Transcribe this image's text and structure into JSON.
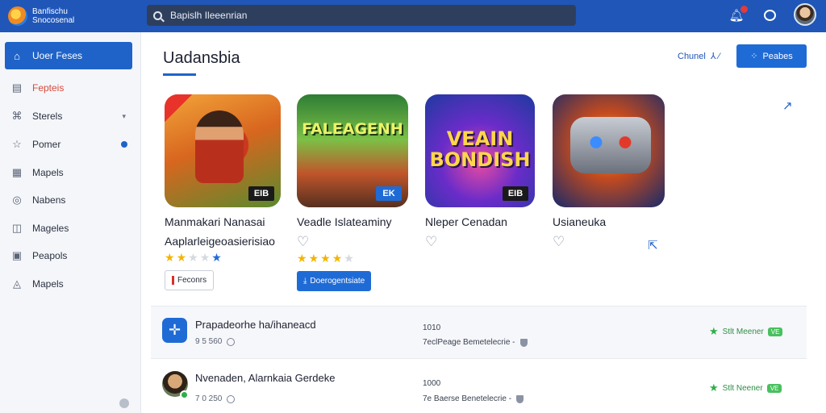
{
  "app": {
    "brand_line1": "Banfischu",
    "brand_line2": "Snocosenal"
  },
  "search": {
    "value": "Bapislh Ileeenrian"
  },
  "sidebar": {
    "items": [
      {
        "label": "Uoer Feses",
        "icon": "home-icon"
      },
      {
        "label": "Fepteis",
        "icon": "calendar-icon"
      },
      {
        "label": "Sterels",
        "icon": "tag-icon"
      },
      {
        "label": "Pomer",
        "icon": "star-icon"
      },
      {
        "label": "Mapels",
        "icon": "grid-icon"
      },
      {
        "label": "Nabens",
        "icon": "circle-icon"
      },
      {
        "label": "Mageles",
        "icon": "chart-icon"
      },
      {
        "label": "Peapols",
        "icon": "image-icon"
      },
      {
        "label": "Mapels",
        "icon": "pin-icon"
      }
    ]
  },
  "main": {
    "title": "Uadansbia",
    "header_link": "Chunel",
    "header_link_icons": "⅄ ⁄",
    "primary_button": "Peabes"
  },
  "cards": [
    {
      "name": "Manmakari Nanasai",
      "sub": "Aaplarleigeoasierisiao",
      "badge": "EIB",
      "rating": 2,
      "button": "Feconrs",
      "tile_text": ""
    },
    {
      "name": "Veadle Islateaminy",
      "sub": "",
      "badge": "EK",
      "rating": 4,
      "button": "Doerogentsiate",
      "tile_text": "FALEAGENH"
    },
    {
      "name": "Nleper Cenadan",
      "sub": "",
      "badge": "EIB",
      "rating": 0,
      "button": "",
      "tile_text": "VEAIN BONDISH"
    },
    {
      "name": "Usianeuka",
      "sub": "",
      "badge": "",
      "rating": 0,
      "button": "",
      "tile_text": ""
    }
  ],
  "list": [
    {
      "title": "Prapadeorhe ha/ihaneacd",
      "meta": "9 5 560",
      "count": "1010",
      "sub": "7eclPeage Bemetelecrie -",
      "status": "Stlt Meener",
      "status_badge": "VE"
    },
    {
      "title": "Nvenaden, Alarnkaia Gerdeke",
      "meta": "7 0 250",
      "count": "1000",
      "sub": "7e Baerse Benetelecrie -",
      "status": "Stlt Neener",
      "status_badge": "VE"
    }
  ],
  "colors": {
    "topbar": "#1f56b8",
    "accent": "#1f6bd6",
    "success": "#2fae4a",
    "star": "#f4b400"
  }
}
